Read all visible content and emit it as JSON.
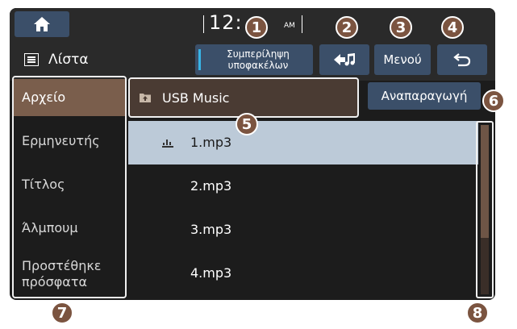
{
  "status": {
    "clock": "12:",
    "ampm": "AM"
  },
  "toolbar": {
    "title": "Λίστα",
    "subfolders_label_1": "Συμπερίληψη",
    "subfolders_label_2": "υποφακέλων",
    "menu_label": "Μενού"
  },
  "sidebar": {
    "items": [
      {
        "label": "Αρχείο"
      },
      {
        "label": "Ερμηνευτής"
      },
      {
        "label": "Τίτλος"
      },
      {
        "label": "Άλμπουμ"
      },
      {
        "label_1": "Προστέθηκε",
        "label_2": "πρόσφατα"
      }
    ],
    "selected": "Αρχείο"
  },
  "breadcrumb": {
    "label": "USB Music"
  },
  "play_label": "Αναπαραγωγή",
  "files": [
    {
      "name": "1.mp3",
      "playing": true
    },
    {
      "name": "2.mp3"
    },
    {
      "name": "3.mp3"
    },
    {
      "name": "4.mp3"
    }
  ],
  "scrollbar": {
    "position_fraction": 0.0,
    "visible_fraction": 0.67
  },
  "callouts": [
    "1",
    "2",
    "3",
    "4",
    "5",
    "6",
    "7",
    "8"
  ],
  "colors": {
    "background": "#1c1c1c",
    "button": "#3b4f69",
    "accent": "#38b5e6",
    "selected_category": "#7a5e4c",
    "selected_row": "#bccad8",
    "callout": "#7b5440"
  },
  "icons": {
    "home": "home-icon",
    "list": "list-menu-icon",
    "music_folder_up": "music-folder-up-icon",
    "back": "back-arrow-icon",
    "folder": "folder-up-icon",
    "playing": "equalizer-icon"
  }
}
